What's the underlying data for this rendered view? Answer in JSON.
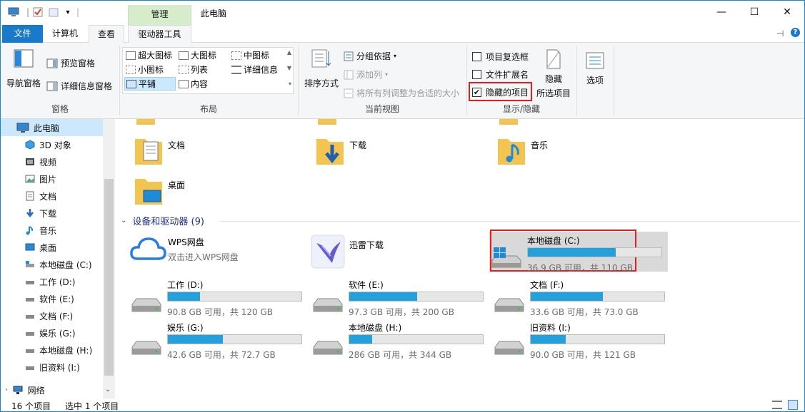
{
  "window": {
    "title": "此电脑",
    "context_tab": "管理",
    "minimize": "—",
    "maximize": "☐",
    "close": "✕"
  },
  "tabs": {
    "file": "文件",
    "computer": "计算机",
    "view": "查看",
    "drive_tools": "驱动器工具"
  },
  "ribbon": {
    "pane": {
      "nav_pane": "导航窗格",
      "preview_pane": "预览窗格",
      "details_pane": "详细信息窗格",
      "label": "窗格"
    },
    "layout": {
      "items": [
        "超大图标",
        "大图标",
        "中图标",
        "小图标",
        "列表",
        "详细信息",
        "平铺",
        "内容"
      ],
      "selected": "平铺",
      "label": "布局"
    },
    "current_view": {
      "sort_by": "排序方式",
      "group_by": "分组依据",
      "add_column": "添加列",
      "fit_columns": "将所有列调整为合适的大小",
      "label": "当前视图"
    },
    "show_hide": {
      "item_checkboxes": "项目复选框",
      "file_extensions": "文件扩展名",
      "hidden_items": "隐藏的项目",
      "hide_selected_1": "隐藏",
      "hide_selected_2": "所选项目",
      "label": "显示/隐藏",
      "item_checkboxes_checked": false,
      "file_extensions_checked": false,
      "hidden_items_checked": true
    },
    "options": "选项"
  },
  "sidebar": {
    "items": [
      "此电脑",
      "3D 对象",
      "视频",
      "图片",
      "文档",
      "下载",
      "音乐",
      "桌面",
      "本地磁盘 (C:)",
      "工作 (D:)",
      "软件 (E:)",
      "文档 (F:)",
      "娱乐 (G:)",
      "本地磁盘 (H:)",
      "旧资料 (I:)",
      "网络"
    ]
  },
  "folders": [
    "文档",
    "下载",
    "音乐",
    "桌面"
  ],
  "devices": {
    "header": "设备和驱动器 (9)",
    "wps": {
      "name": "WPS网盘",
      "sub": "双击进入WPS网盘"
    },
    "thunder": {
      "name": "迅雷下载"
    },
    "drives": [
      {
        "name": "本地磁盘 (C:)",
        "info": "36.9 GB 可用，共 110 GB",
        "used": 0.66
      },
      {
        "name": "工作 (D:)",
        "info": "90.8 GB 可用，共 120 GB",
        "used": 0.24
      },
      {
        "name": "软件 (E:)",
        "info": "97.3 GB 可用，共 200 GB",
        "used": 0.51
      },
      {
        "name": "文档 (F:)",
        "info": "33.6 GB 可用，共 73.0 GB",
        "used": 0.54
      },
      {
        "name": "娱乐 (G:)",
        "info": "42.6 GB 可用，共 72.7 GB",
        "used": 0.41
      },
      {
        "name": "本地磁盘 (H:)",
        "info": "286 GB 可用，共 344 GB",
        "used": 0.17
      },
      {
        "name": "旧资料 (I:)",
        "info": "90.0 GB 可用，共 121 GB",
        "used": 0.26
      }
    ]
  },
  "status": {
    "count": "16 个项目",
    "selected": "选中 1 个项目"
  },
  "colors": {
    "accent": "#1979ca",
    "bar_fill": "#26a0da",
    "highlight": "#e02020"
  }
}
